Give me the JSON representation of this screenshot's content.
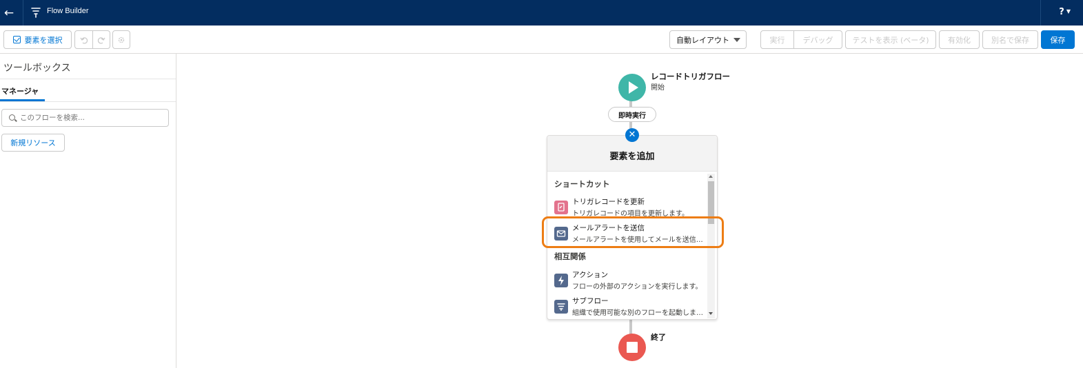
{
  "header": {
    "app_title": "Flow Builder",
    "help_label": "?",
    "back_icon": "arrow-left-icon",
    "flow_icon": "flow-icon"
  },
  "toolbar": {
    "select_elements_label": "要素を選択",
    "layout_select_value": "自動レイアウト",
    "run_label": "実行",
    "debug_label": "デバッグ",
    "view_tests_label": "テストを表示 (ベータ)",
    "activate_label": "有効化",
    "save_as_label": "別名で保存",
    "save_label": "保存"
  },
  "toolbox": {
    "title": "ツールボックス",
    "tab_manager": "マネージャ",
    "search_placeholder": "このフローを検索...",
    "new_resource_label": "新規リソース"
  },
  "canvas": {
    "start_title": "レコードトリガフロー",
    "start_subtitle": "開始",
    "path_label": "即時実行",
    "end_label": "終了"
  },
  "add_element_popover": {
    "title": "要素を追加",
    "sections": [
      {
        "heading": "ショートカット",
        "items": [
          {
            "label": "トリガレコードを更新",
            "description": "トリガレコードの項目を更新します。"
          },
          {
            "label": "メールアラートを送信",
            "description": "メールアラートを使用してメールを送信します。"
          }
        ]
      },
      {
        "heading": "相互関係",
        "items": [
          {
            "label": "アクション",
            "description": "フローの外部のアクションを実行します。"
          },
          {
            "label": "サブフロー",
            "description": "組織で使用可能な別のフローを起動します。"
          }
        ]
      }
    ]
  },
  "colors": {
    "header_bg": "#032d60",
    "brand": "#0176d3",
    "start_node": "#3fb6a8",
    "end_node": "#ea5851",
    "highlight": "#ed7d14",
    "update_icon": "#e3738d",
    "email_icon": "#54698d",
    "action_icon": "#54698d",
    "subflow_icon": "#54698d"
  }
}
